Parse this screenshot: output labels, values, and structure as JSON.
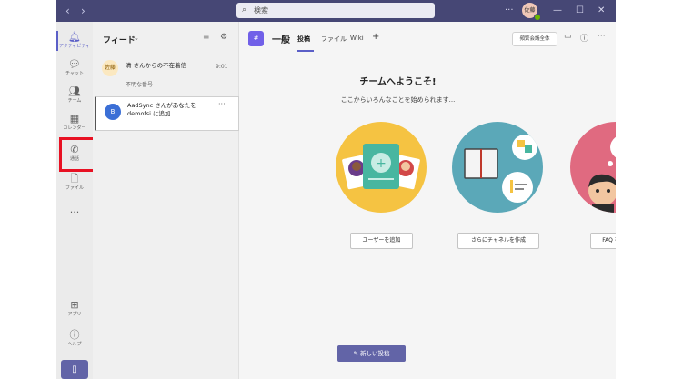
{
  "titlebar": {
    "search_placeholder": "検索",
    "avatar_text": "佐藤"
  },
  "rail": {
    "items": [
      {
        "label": "アクティビティ"
      },
      {
        "label": "チャット"
      },
      {
        "label": "チーム"
      },
      {
        "label": "カレンダー"
      },
      {
        "label": "通話"
      },
      {
        "label": "ファイル"
      },
      {
        "label": "..."
      }
    ],
    "bottom_items": [
      {
        "label": "アプリ"
      },
      {
        "label": "ヘルプ"
      }
    ]
  },
  "feed": {
    "title": "フィード",
    "items": [
      {
        "avatar": "佐藤",
        "text": "清 さんからの不在着信",
        "sub": "不明な番号",
        "time": "9:01"
      },
      {
        "avatar": "B",
        "text": "AadSync さんがあなたを demofsi に追加...",
        "sub": "",
        "time": ""
      }
    ]
  },
  "channel": {
    "icon_text": "#",
    "name": "一般",
    "tabs": [
      {
        "label": "投稿",
        "active": true
      },
      {
        "label": "ファイル",
        "active": false
      },
      {
        "label": "Wiki",
        "active": false
      },
      {
        "label": "+",
        "active": false
      }
    ],
    "meet_label": "頻繁会議全体"
  },
  "welcome": {
    "title": "チームへようこそ!",
    "subtitle": "ここからいろんなことを始められます..."
  },
  "actions": [
    {
      "label": "ユーザーを追加"
    },
    {
      "label": "さらにチャネルを作成"
    },
    {
      "label": "FAQ を開く"
    }
  ],
  "new_post_label": "新しい投稿",
  "colors": {
    "titlebar": "#464775",
    "accent": "#6264a7",
    "highlight_box": "#e81123",
    "illus_yellow": "#f5c342",
    "illus_teal": "#5ba8b8",
    "illus_pink": "#e06a80"
  }
}
